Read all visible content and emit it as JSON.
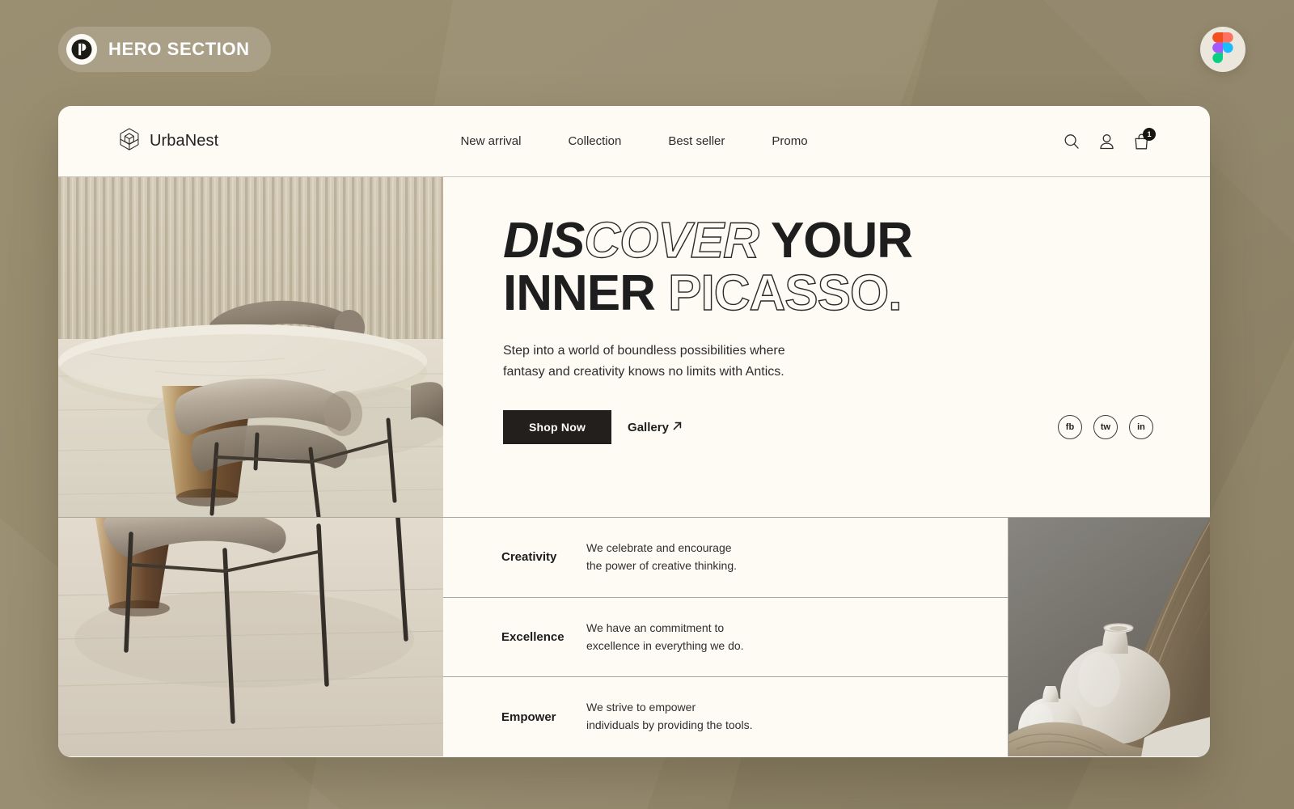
{
  "badge": {
    "label": "HERO SECTION",
    "mark_icon": "figma-style-p-logo-icon"
  },
  "figma_bubble": {
    "icon": "figma-logo-icon"
  },
  "site": {
    "navbar": {
      "brand": {
        "logo_icon": "isometric-cube-logo-icon",
        "name": "UrbaNest"
      },
      "links": [
        {
          "label": "New arrival"
        },
        {
          "label": "Collection"
        },
        {
          "label": "Best seller"
        },
        {
          "label": "Promo"
        }
      ],
      "actions": {
        "search_icon": "search-icon",
        "account_icon": "user-icon",
        "cart_icon": "shopping-bag-icon",
        "cart_count": "1"
      }
    },
    "hero": {
      "photo_alt": "dining-room-with-round-marble-table-and-curved-beige-velvet-chairs",
      "headline": {
        "line1_solid_italic": "DIS",
        "line1_outline_italic": "COVER",
        "line1_solid": "YOUR",
        "line2_solid": "INNER",
        "line2_outline": "PICASSO."
      },
      "subcopy_line1": "Step into a world of boundless possibilities where",
      "subcopy_line2": "fantasy and creativity knows no limits with Antics.",
      "cta": {
        "primary_label": "Shop Now",
        "secondary_label": "Gallery",
        "secondary_icon": "arrow-up-right-icon"
      },
      "socials": [
        {
          "label": "fb",
          "name": "facebook"
        },
        {
          "label": "tw",
          "name": "twitter"
        },
        {
          "label": "in",
          "name": "instagram"
        }
      ]
    },
    "features": [
      {
        "title": "Creativity",
        "desc_line1": "We celebrate and encourage",
        "desc_line2": "the power of creative thinking."
      },
      {
        "title": "Excellence",
        "desc_line1": "We have an commitment to",
        "desc_line2": "excellence in everything we do."
      },
      {
        "title": "Empower",
        "desc_line1": "We strive to empower",
        "desc_line2": "individuals by providing the tools."
      }
    ],
    "features_photo_alt": "ceramic-vases-on-linen-drapery-still-life"
  },
  "colors": {
    "page_background": "#968a6d",
    "card_background": "#fdfbf4",
    "text_primary": "#1e1e1e",
    "button_dark": "#221f1c",
    "divider": "#a9a69d",
    "badge_fill": "rgba(255,255,255,0.16)"
  }
}
